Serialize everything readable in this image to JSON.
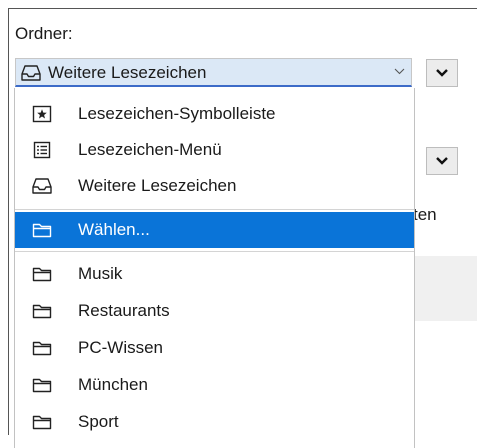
{
  "form": {
    "folder_label": "Ordner:",
    "selected_value": "Weitere Lesezeichen",
    "behind_text": "ten"
  },
  "menu": {
    "top_items": [
      {
        "label": "Lesezeichen-Symbolleiste",
        "icon": "bookmark-star-icon"
      },
      {
        "label": "Lesezeichen-Menü",
        "icon": "list-icon"
      },
      {
        "label": "Weitere Lesezeichen",
        "icon": "inbox-tray-icon"
      }
    ],
    "choose": {
      "label": "Wählen...",
      "icon": "folder-icon",
      "selected": true
    },
    "folders": [
      {
        "label": "Musik",
        "icon": "folder-icon"
      },
      {
        "label": "Restaurants",
        "icon": "folder-icon"
      },
      {
        "label": "PC-Wissen",
        "icon": "folder-icon"
      },
      {
        "label": "München",
        "icon": "folder-icon"
      },
      {
        "label": "Sport",
        "icon": "folder-icon"
      }
    ]
  },
  "colors": {
    "selection": "#0a74d8",
    "combo_background": "#dbe8f6",
    "combo_focus_border": "#3c6bc8"
  }
}
